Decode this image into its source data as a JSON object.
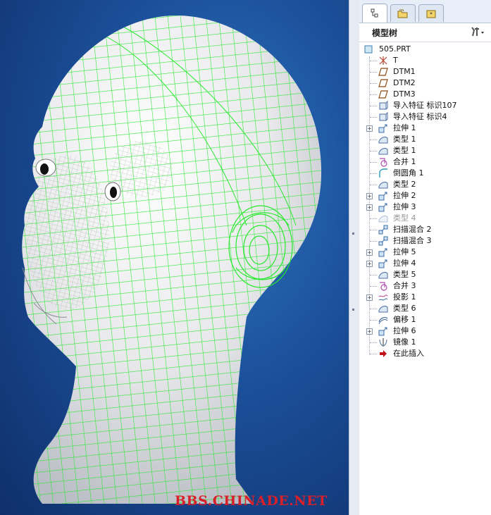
{
  "viewport": {
    "watermark": "BBS.CHINADE.NET"
  },
  "panel": {
    "tabs": [
      {
        "name": "model-tree-tab-icon"
      },
      {
        "name": "folder-browser-tab-icon"
      },
      {
        "name": "favorites-tab-icon"
      }
    ],
    "tree_title": "模型树",
    "settings_icon": "settings-tools-icon",
    "root": "505.PRT",
    "items": [
      {
        "label": "T",
        "icon": "csys-icon",
        "expandable": false
      },
      {
        "label": "DTM1",
        "icon": "datum-plane-icon",
        "expandable": false
      },
      {
        "label": "DTM2",
        "icon": "datum-plane-icon",
        "expandable": false
      },
      {
        "label": "DTM3",
        "icon": "datum-plane-icon",
        "expandable": false
      },
      {
        "label": "导入特征 标识107",
        "icon": "import-feature-icon",
        "expandable": false
      },
      {
        "label": "导入特征 标识4",
        "icon": "import-feature-icon",
        "expandable": false
      },
      {
        "label": "拉伸 1",
        "icon": "extrude-icon",
        "expandable": true
      },
      {
        "label": "类型 1",
        "icon": "style-icon",
        "expandable": false
      },
      {
        "label": "类型 1",
        "icon": "style-icon",
        "expandable": false
      },
      {
        "label": "合并 1",
        "icon": "merge-icon",
        "expandable": false
      },
      {
        "label": "倒圆角 1",
        "icon": "round-icon",
        "expandable": false
      },
      {
        "label": "类型 2",
        "icon": "style-icon",
        "expandable": false
      },
      {
        "label": "拉伸 2",
        "icon": "extrude-icon",
        "expandable": true
      },
      {
        "label": "拉伸 3",
        "icon": "extrude-icon",
        "expandable": true
      },
      {
        "label": "类型 4",
        "icon": "style-icon",
        "expandable": false,
        "suppressed": true
      },
      {
        "label": "扫描混合 2",
        "icon": "swept-blend-icon",
        "expandable": false
      },
      {
        "label": "扫描混合 3",
        "icon": "swept-blend-icon",
        "expandable": false
      },
      {
        "label": "拉伸 5",
        "icon": "extrude-icon",
        "expandable": true
      },
      {
        "label": "拉伸 4",
        "icon": "extrude-icon",
        "expandable": true
      },
      {
        "label": "类型 5",
        "icon": "style-icon",
        "expandable": false
      },
      {
        "label": "合并 3",
        "icon": "merge-icon",
        "expandable": false
      },
      {
        "label": "投影 1",
        "icon": "project-icon",
        "expandable": true
      },
      {
        "label": "类型 6",
        "icon": "style-icon",
        "expandable": false
      },
      {
        "label": "偏移 1",
        "icon": "offset-icon",
        "expandable": false
      },
      {
        "label": "拉伸 6",
        "icon": "extrude-icon",
        "expandable": true
      },
      {
        "label": "镜像 1",
        "icon": "mirror-icon",
        "expandable": false
      },
      {
        "label": "在此插入",
        "icon": "insert-here-arrow-icon",
        "expandable": false
      }
    ]
  }
}
